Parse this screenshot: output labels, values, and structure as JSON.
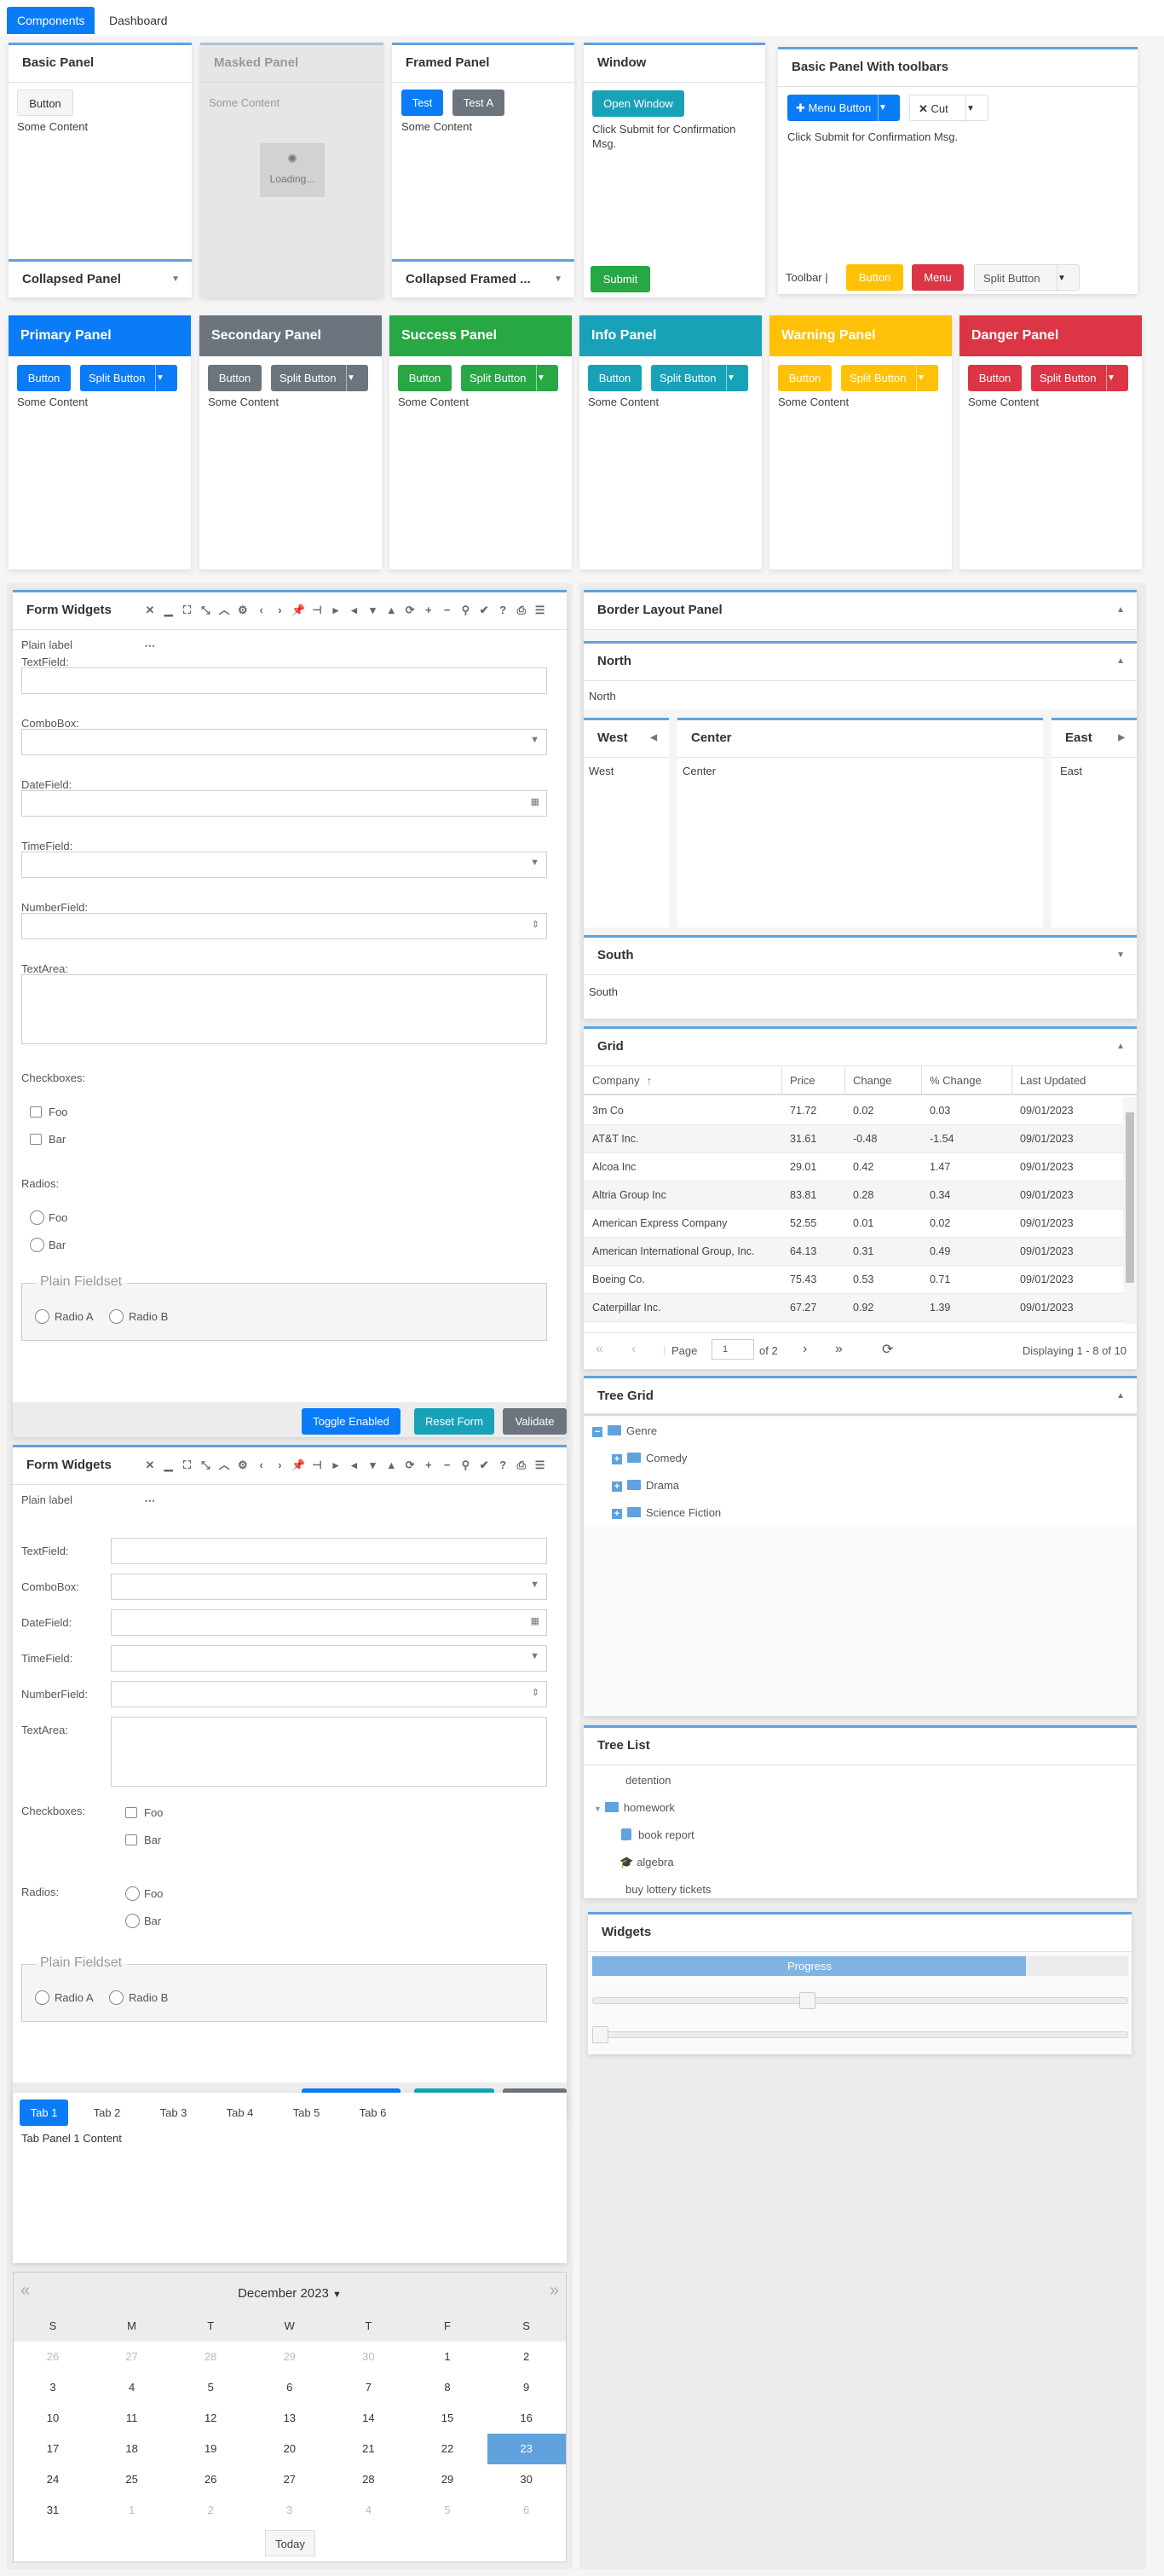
{
  "nav": {
    "tabs": [
      "Components",
      "Dashboard"
    ],
    "active": "Components"
  },
  "colors": {
    "primary": "#0a7cf7",
    "secondary": "#6c757d",
    "success": "#28a745",
    "info": "#17a2b8",
    "warning": "#ffc107",
    "danger": "#dc3545",
    "accent": "#5fa2dd"
  },
  "basic": {
    "title": "Basic Panel",
    "button": "Button",
    "content": "Some Content",
    "collapsed_title": "Collapsed Panel"
  },
  "masked": {
    "title": "Masked Panel",
    "content": "Some Content",
    "loading": "Loading..."
  },
  "framed": {
    "title": "Framed Panel",
    "btn1": "Test",
    "btn2": "Test A",
    "content": "Some Content",
    "collapsed_title": "Collapsed Framed ..."
  },
  "window": {
    "title": "Window",
    "open": "Open Window",
    "msg": "Click Submit for Confirmation Msg.",
    "submit": "Submit"
  },
  "toolbars": {
    "title": "Basic Panel With toolbars",
    "menu_button": "Menu Button",
    "cut": "Cut",
    "msg": "Click Submit for Confirmation Msg.",
    "toolbar_label": "Toolbar |",
    "button": "Button",
    "menu": "Menu",
    "split": "Split Button"
  },
  "colored": [
    {
      "title": "Primary Panel",
      "color": "#0a7cf7",
      "button": "Button",
      "split": "Split Button",
      "content": "Some Content"
    },
    {
      "title": "Secondary Panel",
      "color": "#6c757d",
      "button": "Button",
      "split": "Split Button",
      "content": "Some Content"
    },
    {
      "title": "Success Panel",
      "color": "#28a745",
      "button": "Button",
      "split": "Split Button",
      "content": "Some Content"
    },
    {
      "title": "Info Panel",
      "color": "#17a2b8",
      "button": "Button",
      "split": "Split Button",
      "content": "Some Content"
    },
    {
      "title": "Warning Panel",
      "color": "#ffc107",
      "button": "Button",
      "split": "Split Button",
      "content": "Some Content"
    },
    {
      "title": "Danger Panel",
      "color": "#dc3545",
      "button": "Button",
      "split": "Split Button",
      "content": "Some Content"
    }
  ],
  "form": {
    "title": "Form Widgets",
    "tools": [
      "close",
      "minimize",
      "maximize",
      "restore",
      "collapse",
      "gear",
      "prev",
      "next",
      "pin",
      "unpin",
      "right",
      "left",
      "down",
      "up",
      "refresh",
      "plus",
      "minus",
      "search",
      "save",
      "help",
      "print",
      "expand",
      "collapse-all"
    ],
    "plain_label": "Plain label",
    "textfield": "TextField:",
    "combobox": "ComboBox:",
    "datefield": "DateField:",
    "timefield": "TimeField:",
    "numberfield": "NumberField:",
    "textarea": "TextArea:",
    "checkboxes": "Checkboxes:",
    "radios": "Radios:",
    "foo": "Foo",
    "bar": "Bar",
    "fieldset": "Plain Fieldset",
    "radio_a": "Radio A",
    "radio_b": "Radio B",
    "toggle": "Toggle Enabled",
    "reset": "Reset Form",
    "validate": "Validate"
  },
  "tabs": {
    "items": [
      "Tab 1",
      "Tab 2",
      "Tab 3",
      "Tab 4",
      "Tab 5",
      "Tab 6"
    ],
    "active": 0,
    "content": "Tab Panel 1 Content"
  },
  "calendar": {
    "month": "December 2023",
    "days": [
      "S",
      "M",
      "T",
      "W",
      "T",
      "F",
      "S"
    ],
    "weeks": [
      [
        26,
        27,
        28,
        29,
        30,
        1,
        2
      ],
      [
        3,
        4,
        5,
        6,
        7,
        8,
        9
      ],
      [
        10,
        11,
        12,
        13,
        14,
        15,
        16
      ],
      [
        17,
        18,
        19,
        20,
        21,
        22,
        23
      ],
      [
        24,
        25,
        26,
        27,
        28,
        29,
        30
      ],
      [
        31,
        1,
        2,
        3,
        4,
        5,
        6
      ]
    ],
    "selected": 23,
    "today": "Today"
  },
  "border": {
    "title": "Border Layout Panel",
    "north": "North",
    "west": "West",
    "center": "Center",
    "east": "East",
    "south": "South"
  },
  "grid": {
    "title": "Grid",
    "columns": [
      "Company",
      "Price",
      "Change",
      "% Change",
      "Last Updated"
    ],
    "sort": "Company ascending",
    "rows": [
      [
        "3m Co",
        "71.72",
        "0.02",
        "0.03",
        "09/01/2023"
      ],
      [
        "AT&T Inc.",
        "31.61",
        "-0.48",
        "-1.54",
        "09/01/2023"
      ],
      [
        "Alcoa Inc",
        "29.01",
        "0.42",
        "1.47",
        "09/01/2023"
      ],
      [
        "Altria Group Inc",
        "83.81",
        "0.28",
        "0.34",
        "09/01/2023"
      ],
      [
        "American Express Company",
        "52.55",
        "0.01",
        "0.02",
        "09/01/2023"
      ],
      [
        "American International Group, Inc.",
        "64.13",
        "0.31",
        "0.49",
        "09/01/2023"
      ],
      [
        "Boeing Co.",
        "75.43",
        "0.53",
        "0.71",
        "09/01/2023"
      ],
      [
        "Caterpillar Inc.",
        "67.27",
        "0.92",
        "1.39",
        "09/01/2023"
      ]
    ],
    "paging": {
      "page_label": "Page",
      "page": "1",
      "of": "of 2",
      "display": "Displaying 1 - 8 of 10"
    }
  },
  "treegrid": {
    "title": "Tree Grid",
    "root": "Genre",
    "children": [
      "Comedy",
      "Drama",
      "Science Fiction"
    ]
  },
  "treelist": {
    "title": "Tree List",
    "items": [
      "detention",
      "homework",
      "book report",
      "algebra",
      "buy lottery tickets"
    ]
  },
  "widgets": {
    "title": "Widgets",
    "progress_label": "Progress",
    "progress": 0.81,
    "slider1": 0.4,
    "slider2": 0
  }
}
